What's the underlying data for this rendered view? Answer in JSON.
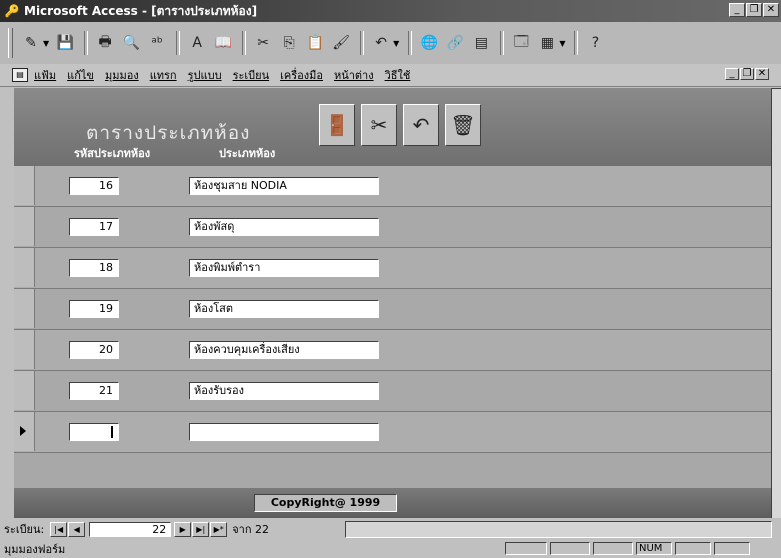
{
  "window": {
    "title": "Microsoft Access - [ตารางประเภทห้อง]",
    "buttons": [
      "_",
      "❐",
      "✕"
    ]
  },
  "toolbar": {
    "items": [
      {
        "name": "view-icon",
        "glyph": "✎"
      },
      {
        "name": "save-icon",
        "glyph": "💾"
      },
      {
        "name": "print-icon",
        "glyph": "🖶"
      },
      {
        "name": "print-preview-icon",
        "glyph": "🔍"
      },
      {
        "name": "spelling-icon",
        "glyph": "ᵃᵇ"
      },
      {
        "name": "field-list-icon",
        "glyph": "A"
      },
      {
        "name": "code-icon",
        "glyph": "📖"
      },
      {
        "name": "cut-icon",
        "glyph": "✂"
      },
      {
        "name": "copy-icon",
        "glyph": "⎘"
      },
      {
        "name": "paste-icon",
        "glyph": "📋"
      },
      {
        "name": "format-painter-icon",
        "glyph": "🖌"
      },
      {
        "name": "undo-icon",
        "glyph": "↶"
      },
      {
        "name": "web-icon",
        "glyph": "🌐"
      },
      {
        "name": "hyperlink-icon",
        "glyph": "🔗"
      },
      {
        "name": "properties-icon",
        "glyph": "▤"
      },
      {
        "name": "database-window-icon",
        "glyph": "🗔"
      },
      {
        "name": "new-object-icon",
        "glyph": "▦"
      },
      {
        "name": "help-icon",
        "glyph": "?"
      }
    ]
  },
  "menu": {
    "items": [
      "แฟ้ม",
      "แก้ไข",
      "มุมมอง",
      "แทรก",
      "รูปแบบ",
      "ระเบียน",
      "เครื่องมือ",
      "หน้าต่าง",
      "วิธีใช้"
    ],
    "buttons": [
      "_",
      "❐",
      "✕"
    ]
  },
  "form": {
    "title": "ตารางประเภทห้อง",
    "col_code": "รหัสประเภทห้อง",
    "col_name": "ประเภทห้อง",
    "actions": [
      {
        "name": "close-form-button",
        "glyph": "🚪"
      },
      {
        "name": "save-record-button",
        "glyph": "✂"
      },
      {
        "name": "undo-record-button",
        "glyph": "↶"
      },
      {
        "name": "delete-record-button",
        "glyph": "🗑"
      }
    ],
    "records": [
      {
        "code": "16",
        "name": "ห้องชุมสาย NODIA"
      },
      {
        "code": "17",
        "name": "ห้องพัสดุ"
      },
      {
        "code": "18",
        "name": "ห้องพิมพ์ตำรา"
      },
      {
        "code": "19",
        "name": "ห้องโสต"
      },
      {
        "code": "20",
        "name": "ห้องควบคุมเครื่องเสียง"
      },
      {
        "code": "21",
        "name": "ห้องรับรอง"
      },
      {
        "code": "",
        "name": "",
        "current": true
      }
    ],
    "copyright": "CopyRight@ 1999"
  },
  "navigation": {
    "label": "ระเบียน:",
    "current": "22",
    "of_text": "จาก 22",
    "buttons": [
      "|◀",
      "◀",
      "▶",
      "▶|",
      "▶*"
    ]
  },
  "status": {
    "text": "มุมมองฟอร์ม",
    "num": "NUM"
  }
}
